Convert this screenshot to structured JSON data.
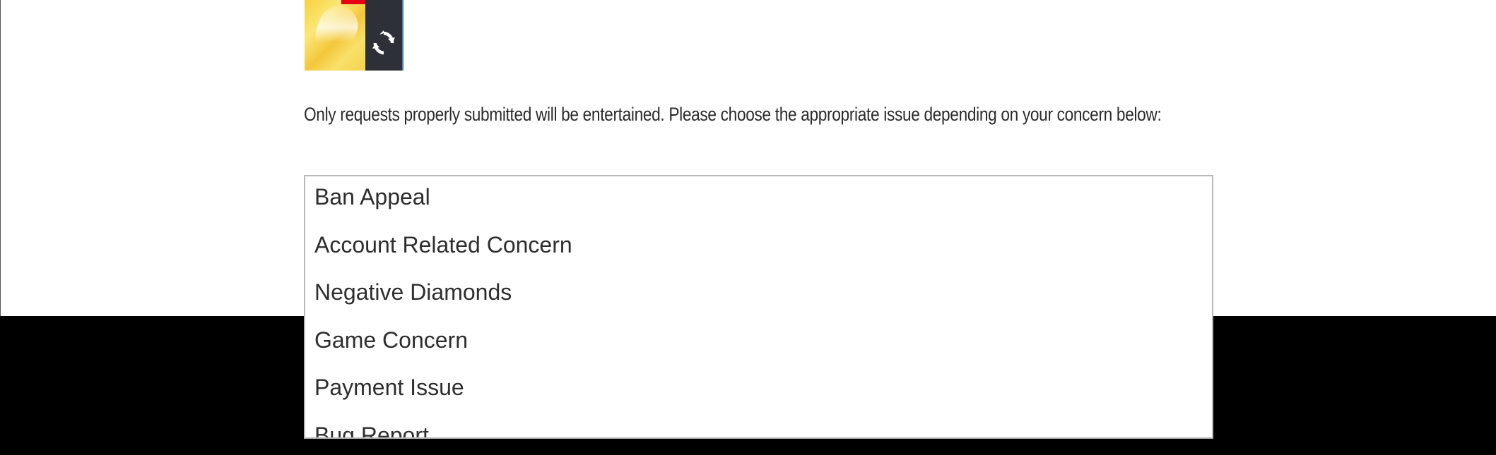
{
  "captcha": {
    "refresh_icon": "refresh-icon"
  },
  "instruction": {
    "text": "Only requests properly submitted will be entertained. Please choose the appropriate issue depending on your concern below:"
  },
  "issue_select": {
    "options": [
      "Ban Appeal",
      "Account Related Concern",
      "Negative Diamonds",
      "Game Concern",
      "Payment Issue",
      "Bug Report"
    ]
  },
  "colors": {
    "footer_background": "#000000",
    "captcha_button": "#2d3137",
    "captcha_accent": "#e60012"
  }
}
